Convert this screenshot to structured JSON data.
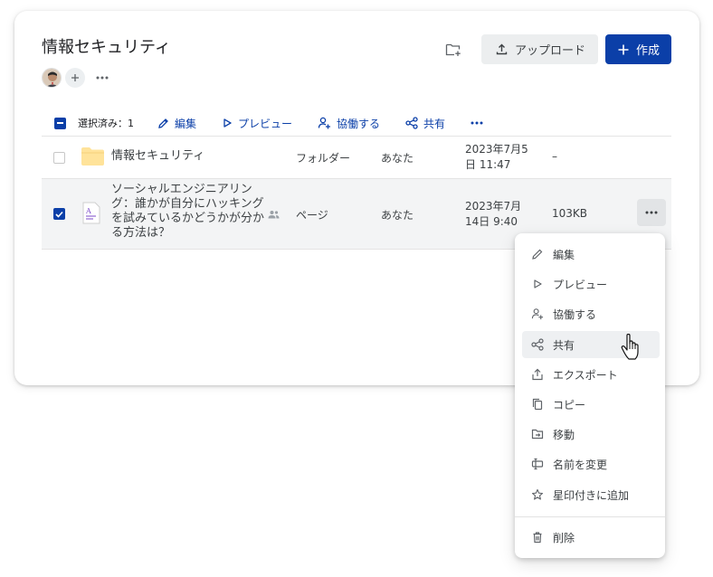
{
  "header": {
    "title": "情報セキュリティ",
    "upload_label": "アップロード",
    "create_label": "作成"
  },
  "toolbar": {
    "selected_count": "選択済み：1",
    "edit": "編集",
    "preview": "プレビュー",
    "collaborate": "協働する",
    "share": "共有"
  },
  "rows": [
    {
      "name": "情報セキュリティ",
      "type": "フォルダー",
      "owner": "あなた",
      "modified_line1": "2023年7月5",
      "modified_line2": "日 11:47",
      "size": "–",
      "checked": false
    },
    {
      "name_line1": "ソーシャルエンジニアリン",
      "name_line2": "グ：誰かが自分にハッキング",
      "name_line3": "を試みているかどうかが分か",
      "name_line4": "る方法は？",
      "type": "ページ",
      "owner": "あなた",
      "modified_line1": "2023年7月",
      "modified_line2": "14日 9:40",
      "size": "103KB",
      "checked": true
    }
  ],
  "context_menu": {
    "items": [
      "編集",
      "プレビュー",
      "協働する",
      "共有",
      "エクスポート",
      "コピー",
      "移動",
      "名前を変更",
      "星印付きに追加"
    ],
    "delete": "削除",
    "hovered": "共有"
  },
  "colors": {
    "accent": "#0b3fa8",
    "upload_bg": "#eceeef",
    "selected_row_bg": "#f3f4f5",
    "folder": "#ffe39a"
  }
}
